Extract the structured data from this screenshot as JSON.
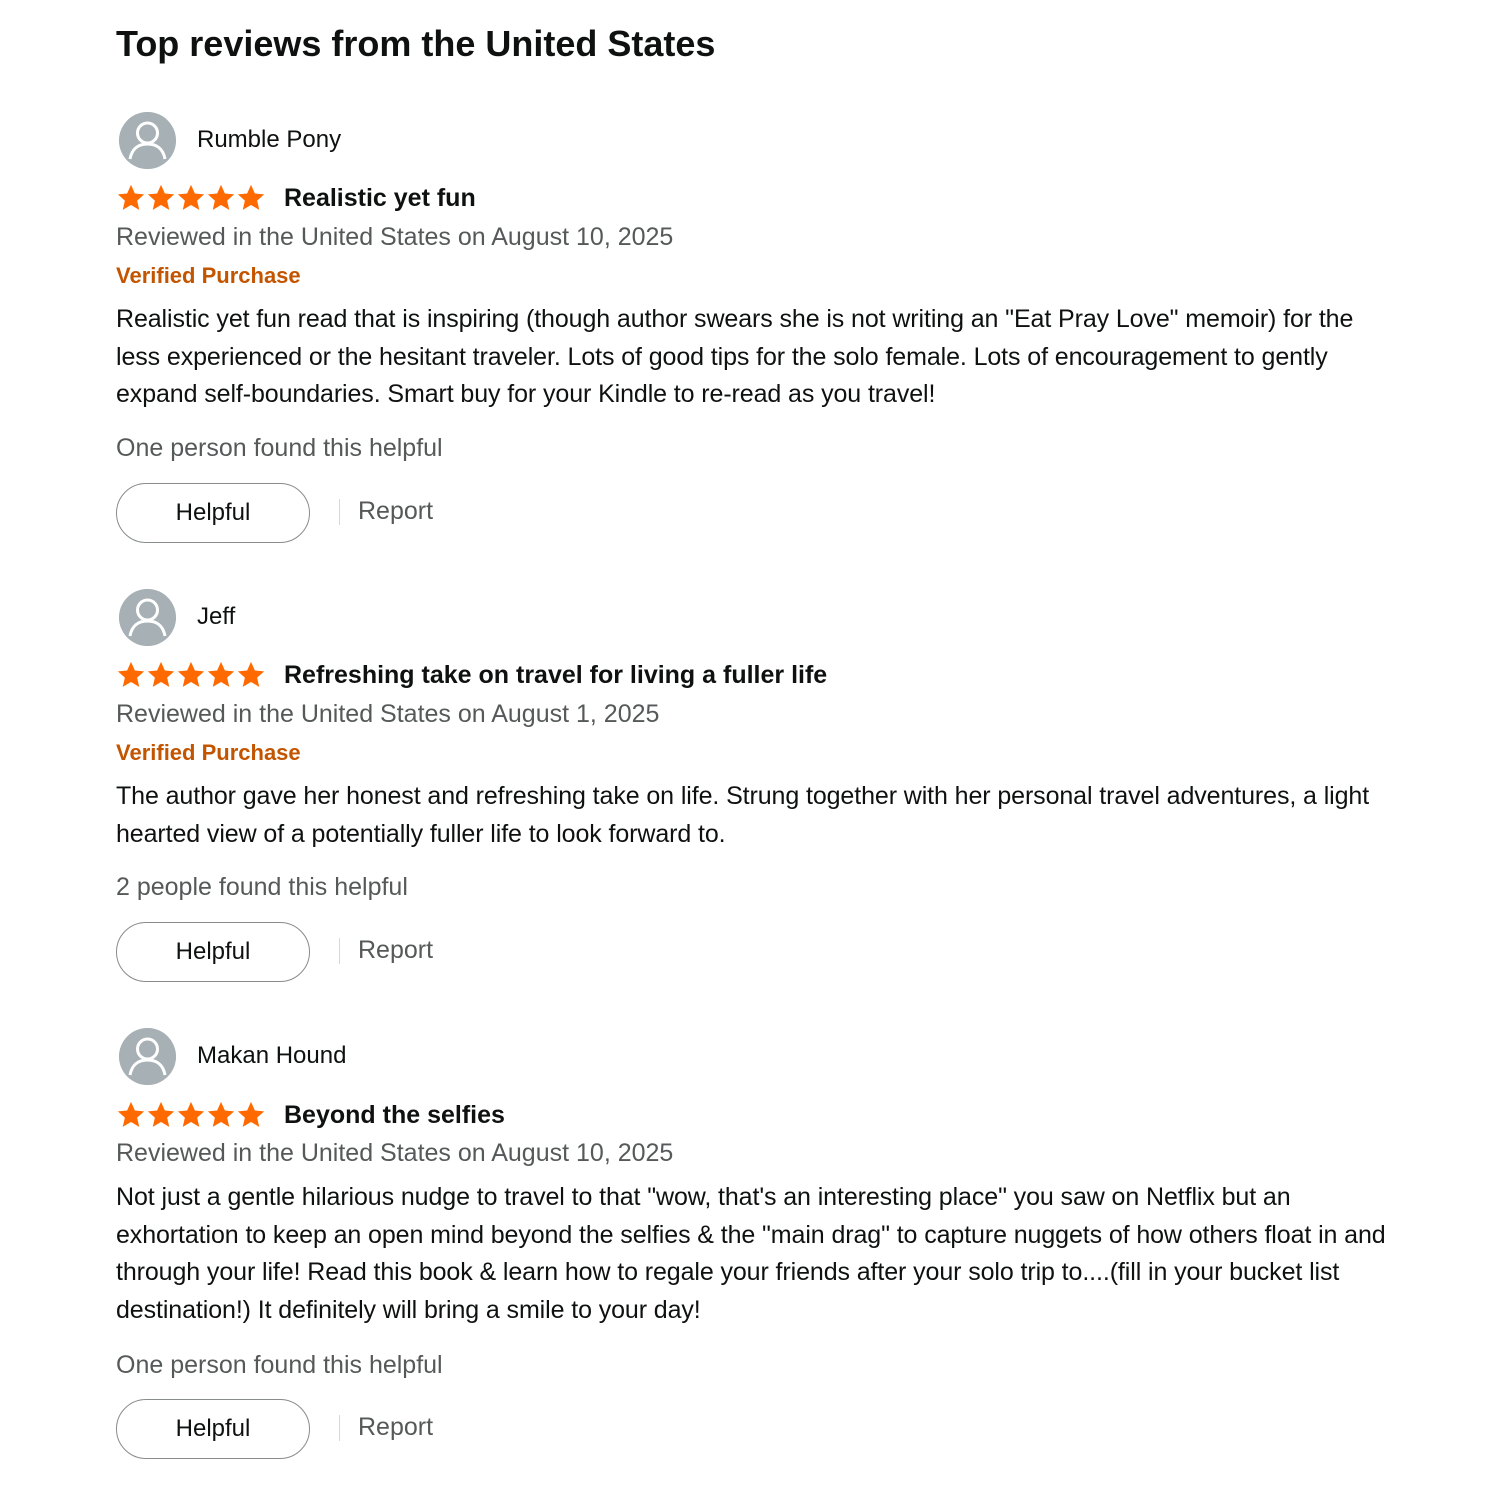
{
  "section_title": "Top reviews from the United States",
  "colors": {
    "star": "#ff6a00",
    "verified": "#c45500",
    "secondary_text": "#565959",
    "avatar_bg": "#a7b1b5"
  },
  "reviews": [
    {
      "reviewer": "Rumble Pony",
      "rating": 5,
      "title": "Realistic yet fun",
      "date": "Reviewed in the United States on August 10, 2025",
      "verified": "Verified Purchase",
      "body": "Realistic yet fun read that is inspiring (though author swears she is not writing an \"Eat Pray Love\" memoir) for the less experienced or the hesitant traveler. Lots of good tips for the solo female. Lots of encouragement to gently expand self-boundaries. Smart buy for your Kindle to re-read as you travel!",
      "helpful_count": "One person found this helpful",
      "helpful_label": "Helpful",
      "report_label": "Report"
    },
    {
      "reviewer": "Jeff",
      "rating": 5,
      "title": "Refreshing take on travel for living a fuller life",
      "date": "Reviewed in the United States on August 1, 2025",
      "verified": "Verified Purchase",
      "body": "The author gave her honest and refreshing take on life. Strung together with her personal travel adventures, a light hearted view of a potentially fuller life to look forward to.",
      "helpful_count": "2 people found this helpful",
      "helpful_label": "Helpful",
      "report_label": "Report"
    },
    {
      "reviewer": "Makan Hound",
      "rating": 5,
      "title": "Beyond the selfies",
      "date": "Reviewed in the United States on August 10, 2025",
      "body": "Not just a gentle hilarious nudge to travel to that \"wow, that's an interesting place\" you saw on Netflix but an exhortation to keep an open mind beyond the selfies & the \"main drag\" to capture nuggets of how others float in and through your life! Read this book & learn how to regale your friends after your solo trip to....(fill in your bucket list destination!) It definitely will bring a smile to your day!",
      "helpful_count": "One person found this helpful",
      "helpful_label": "Helpful",
      "report_label": "Report"
    }
  ]
}
